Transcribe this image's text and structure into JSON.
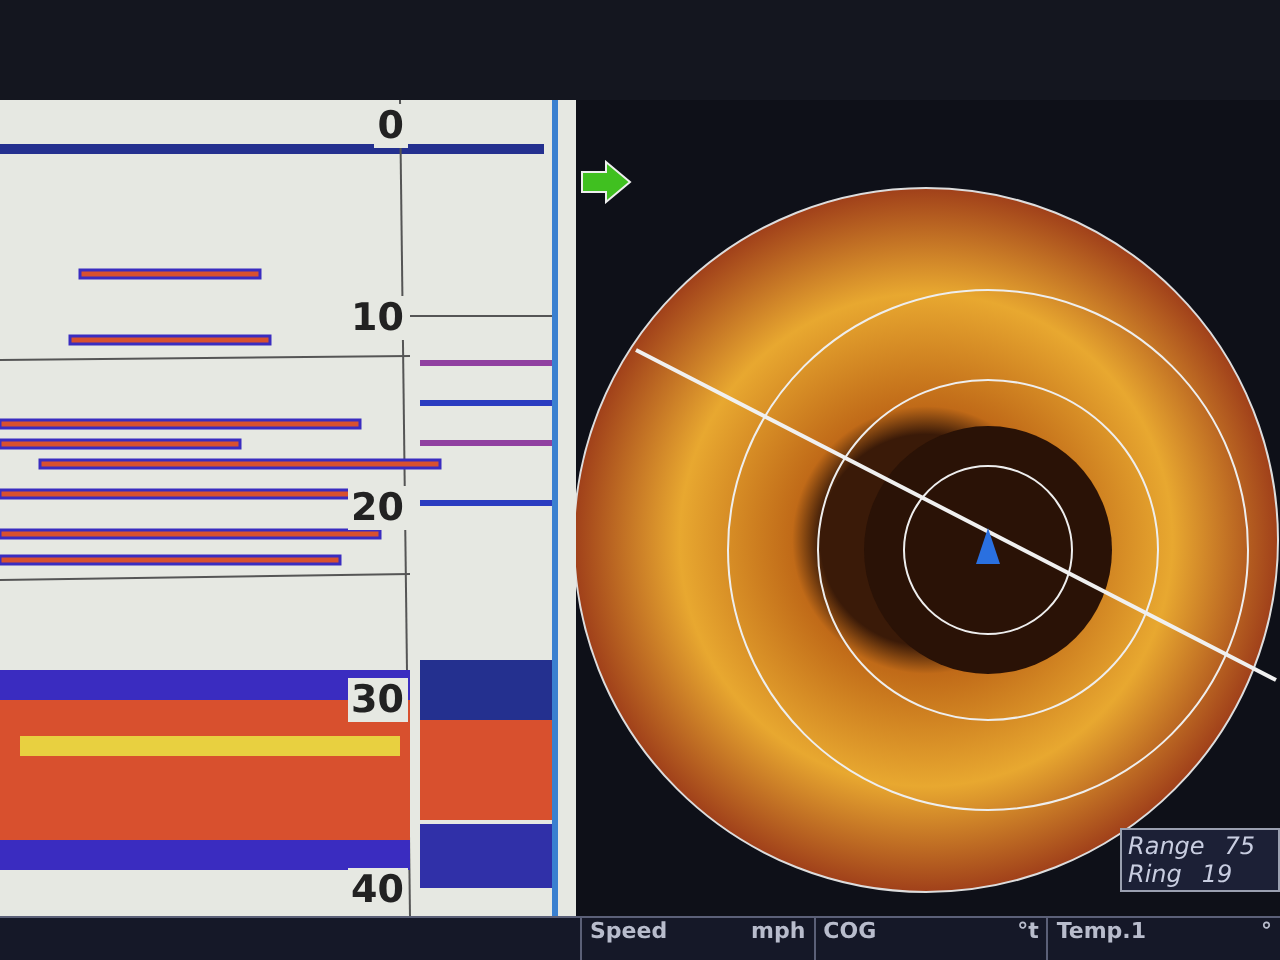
{
  "depth_scale": [
    "0",
    "10",
    "20",
    "30",
    "40"
  ],
  "radar_info": [
    {
      "label": "Range",
      "value": "75"
    },
    {
      "label": "Ring",
      "value": "19"
    }
  ],
  "status_bar": [
    {
      "label": "Speed",
      "unit": "mph"
    },
    {
      "label": "COG",
      "unit": "°t"
    },
    {
      "label": "Temp.1",
      "unit": "°"
    }
  ]
}
